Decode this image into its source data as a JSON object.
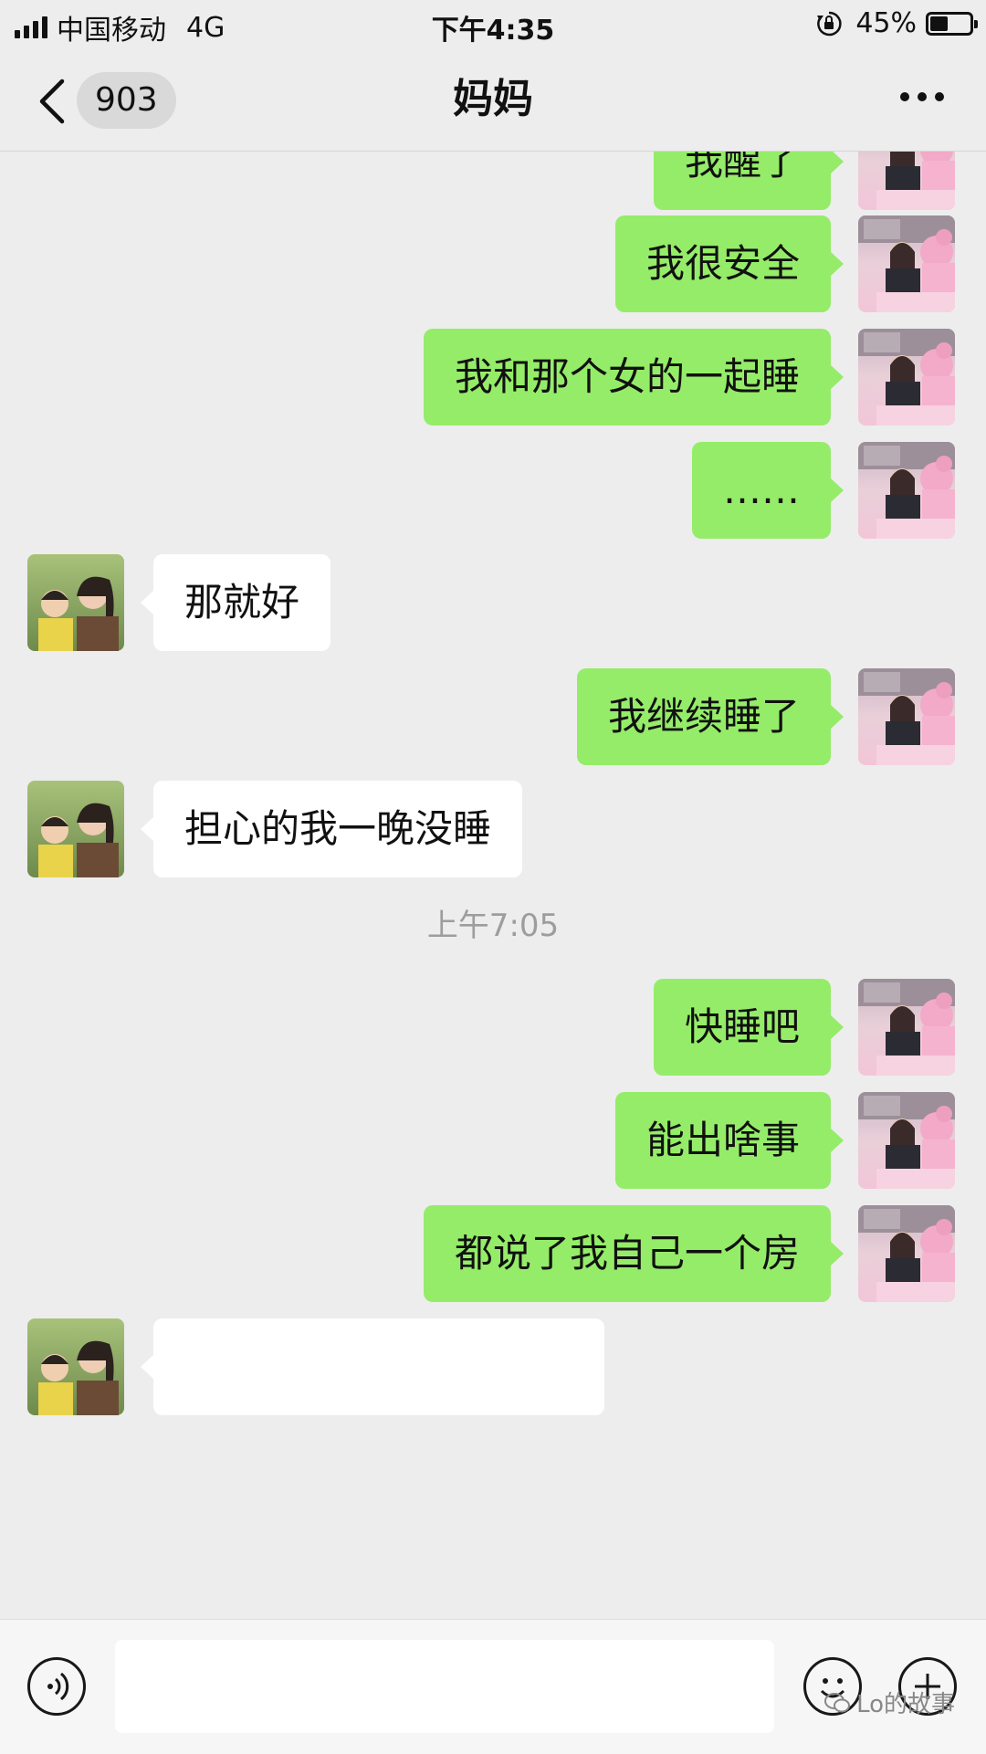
{
  "status_bar": {
    "carrier": "中国移动",
    "network": "4G",
    "time": "下午4:35",
    "battery_percent": "45%",
    "battery_level": 0.45
  },
  "nav": {
    "unread_count": "903",
    "title": "妈妈"
  },
  "messages": [
    {
      "direction": "out",
      "text": "我醒了"
    },
    {
      "direction": "out",
      "text": "我很安全"
    },
    {
      "direction": "out",
      "text": "我和那个女的一起睡"
    },
    {
      "direction": "out",
      "text": "……"
    },
    {
      "direction": "in",
      "text": "那就好"
    },
    {
      "direction": "out",
      "text": "我继续睡了"
    },
    {
      "direction": "in",
      "text": "担心的我一晚没睡"
    },
    {
      "type": "timestamp",
      "text": "上午7:05"
    },
    {
      "direction": "out",
      "text": "快睡吧"
    },
    {
      "direction": "out",
      "text": "能出啥事"
    },
    {
      "direction": "out",
      "text": "都说了我自己一个房"
    },
    {
      "direction": "in",
      "text": ""
    }
  ],
  "input_bar": {
    "placeholder": "",
    "watermark": "Lo的故事"
  },
  "icons": {
    "back": "chevron-left-icon",
    "more": "more-dots-icon",
    "voice": "voice-icon",
    "emoji": "emoji-icon",
    "plus": "plus-icon"
  },
  "colors": {
    "outgoing_bubble": "#95ec69",
    "incoming_bubble": "#ffffff",
    "background": "#ededed"
  }
}
